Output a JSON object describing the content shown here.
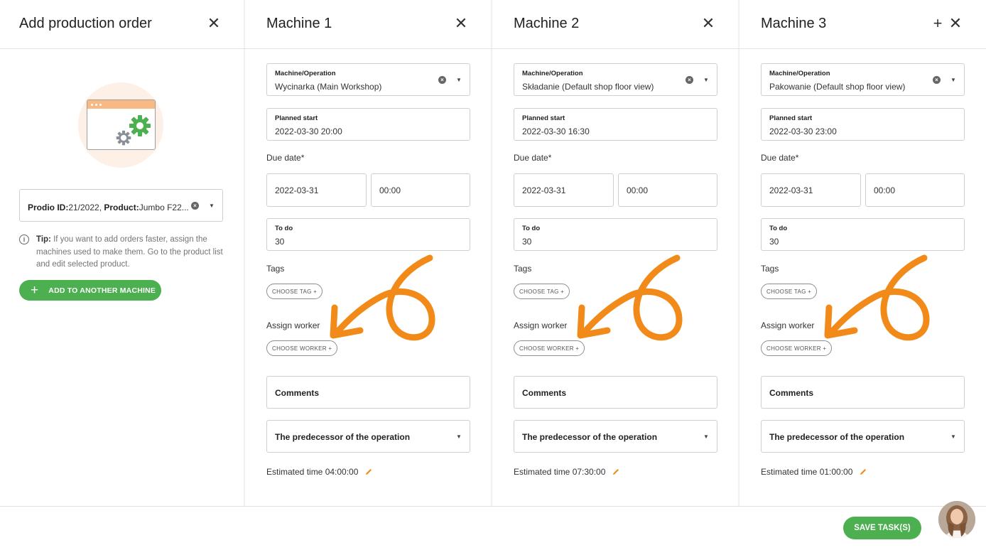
{
  "left": {
    "title": "Add production order",
    "close_icon": "close-icon",
    "selected_order_prefix_id": "Prodio ID:",
    "selected_order_id": "21/2022, ",
    "selected_order_prefix_product": "Product:",
    "selected_order_product": "Jumbo F22...",
    "tip_label": "Tip:",
    "tip_text": " If you want to add orders faster, assign the machines used to make them. Go to the product list and edit selected product.",
    "add_button": "ADD TO ANOTHER MACHINE"
  },
  "labels": {
    "machine_operation": "Machine/Operation",
    "planned_start": "Planned start",
    "due_date": "Due date*",
    "to_do": "To do",
    "tags": "Tags",
    "choose_tag": "CHOOSE TAG +",
    "assign_worker": "Assign worker",
    "choose_worker": "CHOOSE WORKER +",
    "comments": "Comments",
    "predecessor": "The predecessor of the operation",
    "estimated_prefix": "Estimated time"
  },
  "machines": [
    {
      "title": "Machine 1",
      "operation": "Wycinarka   (Main Workshop)",
      "planned_start": "2022-03-30 20:00",
      "due_date": "2022-03-31",
      "due_time": "00:00",
      "to_do": "30",
      "estimated": "Estimated time 04:00:00"
    },
    {
      "title": "Machine 2",
      "operation": "Składanie   (Default shop floor view)",
      "planned_start": "2022-03-30 16:30",
      "due_date": "2022-03-31",
      "due_time": "00:00",
      "to_do": "30",
      "estimated": "Estimated time 07:30:00"
    },
    {
      "title": "Machine 3",
      "operation": "Pakowanie   (Default shop floor view)",
      "planned_start": "2022-03-30 23:00",
      "due_date": "2022-03-31",
      "due_time": "00:00",
      "to_do": "30",
      "estimated": "Estimated time 01:00:00"
    }
  ],
  "footer": {
    "save_button": "SAVE TASK(S)"
  },
  "colors": {
    "accent_green": "#4caf50",
    "annotation_orange": "#f28a1a",
    "illustration_bg": "#fdf0e6"
  }
}
